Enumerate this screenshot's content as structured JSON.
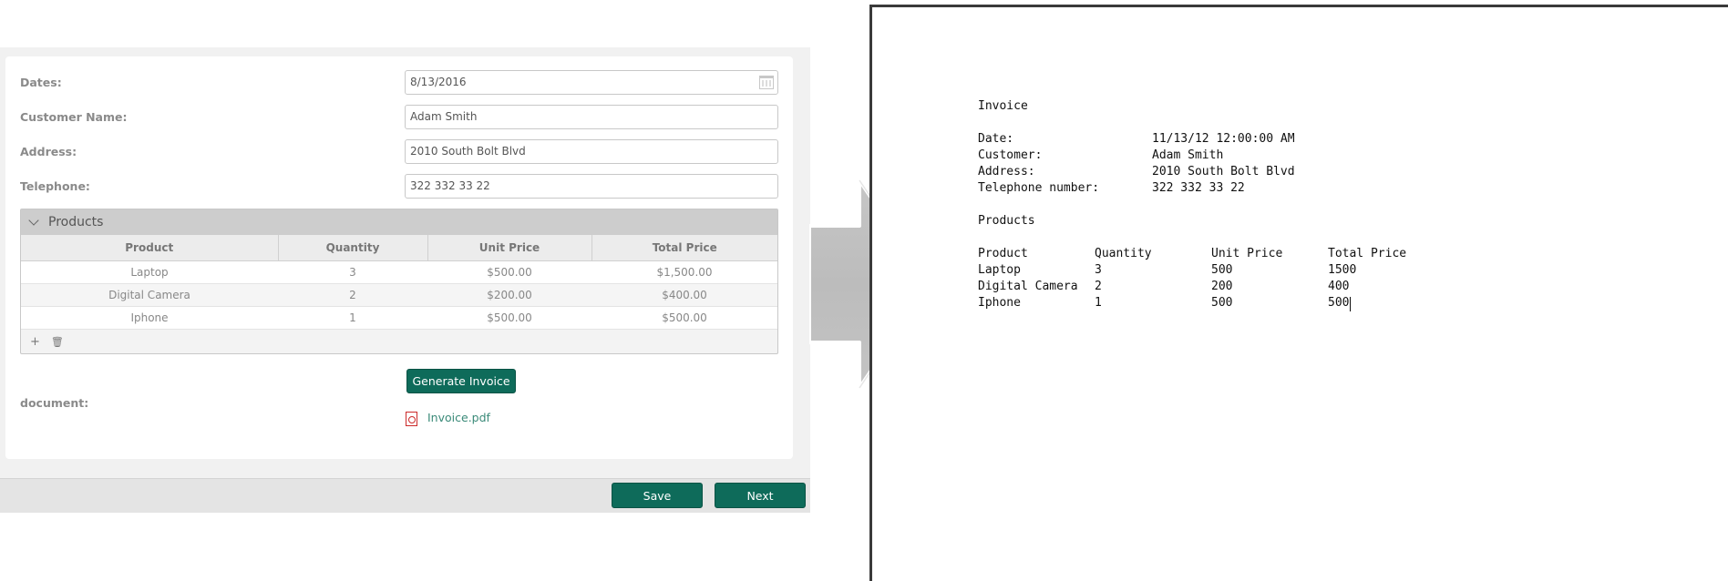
{
  "form": {
    "dates_label": "Dates:",
    "dates_value": "8/13/2016",
    "customer_label": "Customer Name:",
    "customer_value": "Adam Smith",
    "address_label": "Address:",
    "address_value": "2010 South Bolt Blvd",
    "telephone_label": "Telephone:",
    "telephone_value": "322 332 33 22",
    "products_title": "Products",
    "columns": [
      "Product",
      "Quantity",
      "Unit Price",
      "Total Price"
    ],
    "rows": [
      [
        "Laptop",
        "3",
        "$500.00",
        "$1,500.00"
      ],
      [
        "Digital Camera",
        "2",
        "$200.00",
        "$400.00"
      ],
      [
        "Iphone",
        "1",
        "$500.00",
        "$500.00"
      ]
    ],
    "add_glyph": "+",
    "delete_glyph": "🗑",
    "generate_label": "Generate Invoice",
    "document_label": "document:",
    "document_file": "Invoice.pdf",
    "save_label": "Save",
    "next_label": "Next"
  },
  "invoice_doc": {
    "title": "Invoice",
    "date_label": "Date:",
    "date_value": "11/13/12 12:00:00 AM",
    "customer_label": "Customer:",
    "customer_value": "Adam Smith",
    "address_label": "Address:",
    "address_value": "2010 South Bolt Blvd",
    "telephone_label": "Telephone number:",
    "telephone_value": "322 332 33 22",
    "products_title": "Products",
    "columns": [
      "Product",
      "Quantity",
      "Unit Price",
      "Total Price"
    ],
    "rows": [
      [
        "Laptop",
        "3",
        "500",
        "1500"
      ],
      [
        "Digital Camera",
        "2",
        "200",
        "400"
      ],
      [
        "Iphone",
        "1",
        "500",
        "500"
      ]
    ]
  },
  "colors": {
    "accent": "#0e6b5a",
    "link": "#3a8a78",
    "pdf_icon": "#cc2a2a"
  }
}
